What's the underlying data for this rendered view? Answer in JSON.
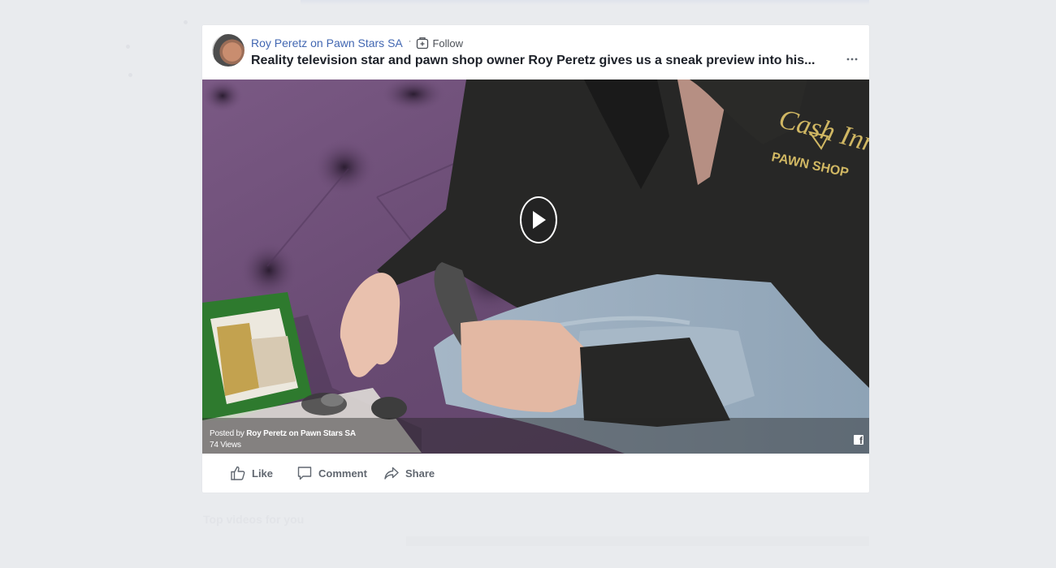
{
  "post": {
    "author": "Roy Peretz on Pawn Stars SA",
    "separator": "·",
    "follow_label": "Follow",
    "title": "Reality television star and pawn shop owner Roy Peretz gives us a sneak preview into his...",
    "more_icon": "more-options-icon"
  },
  "video": {
    "posted_by_prefix": "Posted by",
    "posted_by_name": "Roy Peretz on Pawn Stars SA",
    "views": "74 Views",
    "logo_letter": "f"
  },
  "actions": {
    "like": "Like",
    "comment": "Comment",
    "share": "Share"
  },
  "below": {
    "faint_text": "Top videos for you"
  },
  "colors": {
    "background": "#e9ebee",
    "link": "#4267b2",
    "action_text": "#616770"
  }
}
